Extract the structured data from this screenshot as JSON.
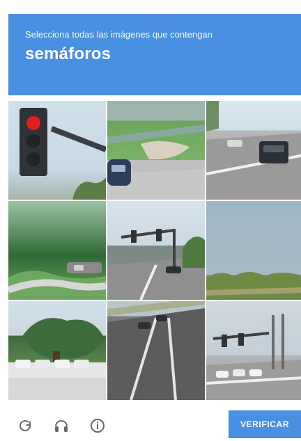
{
  "header": {
    "instruction": "Selecciona todas las imágenes que contengan",
    "keyword": "semáforos"
  },
  "grid": {
    "tiles": [
      {
        "id": 1
      },
      {
        "id": 2
      },
      {
        "id": 3
      },
      {
        "id": 4
      },
      {
        "id": 5
      },
      {
        "id": 6
      },
      {
        "id": 7
      },
      {
        "id": 8
      },
      {
        "id": 9
      }
    ]
  },
  "footer": {
    "verify_label": "VERIFICAR"
  },
  "icons": {
    "reload": "reload-icon",
    "audio": "headphones-icon",
    "info": "info-icon"
  },
  "colors": {
    "accent": "#4a90e2",
    "icon": "#666666"
  }
}
